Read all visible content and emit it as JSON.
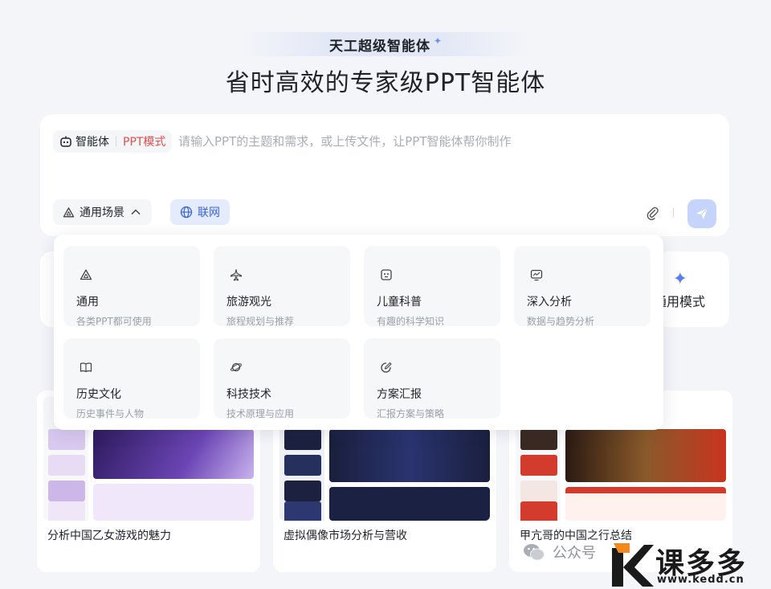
{
  "brand": {
    "name": "天工超级智能体",
    "star_icon": "sparkle-icon"
  },
  "headline": "省时高效的专家级PPT智能体",
  "composer": {
    "agent_label": "智能体",
    "mode_label": "PPT模式",
    "placeholder": "请输入PPT的主题和需求，或上传文件，让PPT智能体帮你制作",
    "value": "",
    "scene_button": "通用场景",
    "web_button": "联网",
    "accent": "#3a64e0",
    "mode_color": "#e84b4b"
  },
  "mode_row": {
    "general_label": "通用模式"
  },
  "scenes": [
    {
      "name": "通用",
      "desc": "各类PPT都可使用",
      "icon": "triangle-icon"
    },
    {
      "name": "旅游观光",
      "desc": "旅程规划与推荐",
      "icon": "airplane-icon"
    },
    {
      "name": "儿童科普",
      "desc": "有趣的科学知识",
      "icon": "robot-face-icon"
    },
    {
      "name": "深入分析",
      "desc": "数据与趋势分析",
      "icon": "monitor-chart-icon"
    },
    {
      "name": "历史文化",
      "desc": "历史事件与人物",
      "icon": "book-icon"
    },
    {
      "name": "科技技术",
      "desc": "技术原理与应用",
      "icon": "planet-icon"
    },
    {
      "name": "方案汇报",
      "desc": "汇报方案与策略",
      "icon": "edit-icon"
    }
  ],
  "examples": [
    {
      "title": "分析中国乙女游戏的魅力"
    },
    {
      "title": "虚拟偶像市场分析与营收"
    },
    {
      "title": "甲亢哥的中国之行总结"
    }
  ],
  "watermark": {
    "text": "公众号",
    "site_name": "课多多",
    "site_url": "www.kedd.cn"
  }
}
